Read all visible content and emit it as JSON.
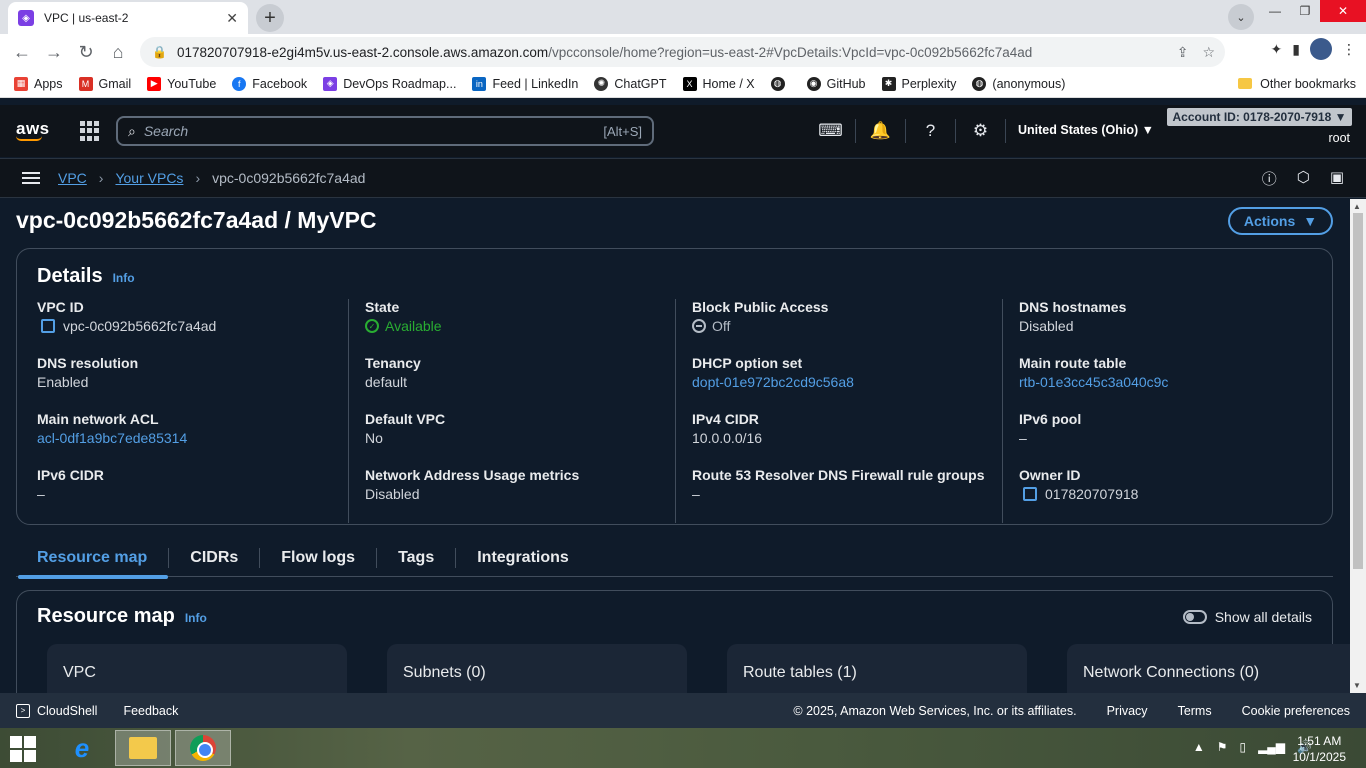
{
  "browser": {
    "tab_title": "VPC | us-east-2",
    "url_host": "017820707918-e2gi4m5v.us-east-2.console.aws.amazon.com",
    "url_path": "/vpcconsole/home?region=us-east-2#VpcDetails:VpcId=vpc-0c092b5662fc7a4ad",
    "bookmarks": [
      "Apps",
      "Gmail",
      "YouTube",
      "Facebook",
      "DevOps Roadmap...",
      "Feed | LinkedIn",
      "ChatGPT",
      "Home / X",
      "",
      "GitHub",
      "Perplexity",
      "(anonymous)"
    ],
    "other_bookmarks": "Other bookmarks"
  },
  "aws": {
    "search_placeholder": "Search",
    "search_shortcut": "[Alt+S]",
    "region": "United States (Ohio) ▼",
    "account": "Account ID: 0178-2070-7918 ▼",
    "user": "root"
  },
  "breadcrumb": {
    "vpc": "VPC",
    "your_vpcs": "Your VPCs",
    "current": "vpc-0c092b5662fc7a4ad"
  },
  "page": {
    "title": "vpc-0c092b5662fc7a4ad / MyVPC",
    "actions": "Actions"
  },
  "details": {
    "heading": "Details",
    "info": "Info",
    "col1": [
      {
        "label": "VPC ID",
        "value": "vpc-0c092b5662fc7a4ad"
      },
      {
        "label": "DNS resolution",
        "value": "Enabled"
      },
      {
        "label": "Main network ACL",
        "value": "acl-0df1a9bc7ede85314"
      },
      {
        "label": "IPv6 CIDR",
        "value": "–"
      }
    ],
    "col2": [
      {
        "label": "State",
        "value": "Available"
      },
      {
        "label": "Tenancy",
        "value": "default"
      },
      {
        "label": "Default VPC",
        "value": "No"
      },
      {
        "label": "Network Address Usage metrics",
        "value": "Disabled"
      }
    ],
    "col3": [
      {
        "label": "Block Public Access",
        "value": "Off"
      },
      {
        "label": "DHCP option set",
        "value": "dopt-01e972bc2cd9c56a8"
      },
      {
        "label": "IPv4 CIDR",
        "value": "10.0.0.0/16"
      },
      {
        "label": "Route 53 Resolver DNS Firewall rule groups",
        "value": "–"
      }
    ],
    "col4": [
      {
        "label": "DNS hostnames",
        "value": "Disabled"
      },
      {
        "label": "Main route table",
        "value": "rtb-01e3cc45c3a040c9c"
      },
      {
        "label": "IPv6 pool",
        "value": "–"
      },
      {
        "label": "Owner ID",
        "value": "017820707918"
      }
    ]
  },
  "tabs": [
    "Resource map",
    "CIDRs",
    "Flow logs",
    "Tags",
    "Integrations"
  ],
  "resource_map": {
    "heading": "Resource map",
    "info": "Info",
    "toggle_label": "Show all details",
    "cards": [
      "VPC",
      "Subnets (0)",
      "Route tables (1)",
      "Network Connections (0)"
    ]
  },
  "footer": {
    "cloudshell": "CloudShell",
    "feedback": "Feedback",
    "copyright": "© 2025, Amazon Web Services, Inc. or its affiliates.",
    "privacy": "Privacy",
    "terms": "Terms",
    "cookies": "Cookie preferences"
  },
  "taskbar": {
    "time": "1:51 AM",
    "date": "10/1/2025"
  }
}
